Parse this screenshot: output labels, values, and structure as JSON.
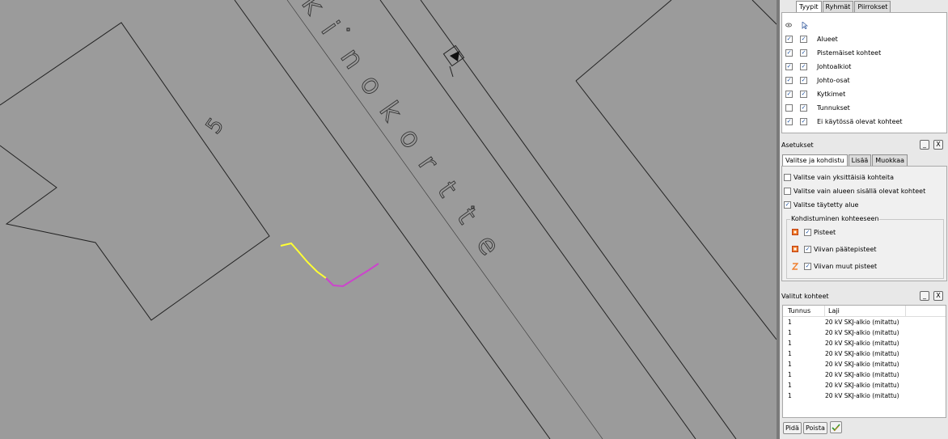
{
  "map": {
    "parcel_number": "5",
    "street_letters": [
      "k",
      "i",
      "n",
      "o",
      "k",
      "o",
      "r",
      "t",
      "t",
      "e"
    ],
    "highlight_colors": {
      "segment_a": "#ffff33",
      "segment_b": "#cc44cc"
    },
    "direction_icon": "triangle-marker-icon"
  },
  "types_panel": {
    "tabs": [
      "Tyypit",
      "Ryhmät",
      "Piirrokset"
    ],
    "col_icons": [
      "eye-icon",
      "pointer-icon"
    ],
    "items": [
      {
        "label": "Alueet",
        "visible": true,
        "selectable": true
      },
      {
        "label": "Pistemäiset kohteet",
        "visible": true,
        "selectable": true
      },
      {
        "label": "Johtoalkiot",
        "visible": true,
        "selectable": true
      },
      {
        "label": "Johto-osat",
        "visible": true,
        "selectable": true
      },
      {
        "label": "Kytkimet",
        "visible": true,
        "selectable": true
      },
      {
        "label": "Tunnukset",
        "visible": false,
        "selectable": true
      },
      {
        "label": "Ei käytössä olevat kohteet",
        "visible": true,
        "selectable": true
      }
    ]
  },
  "settings_panel": {
    "title": "Asetukset",
    "min_label": "_",
    "close_label": "X",
    "tabs": [
      "Valitse ja kohdistu",
      "Lisää",
      "Muokkaa"
    ],
    "options": [
      {
        "label": "Valitse vain yksittäisiä kohteita",
        "checked": false
      },
      {
        "label": "Valitse vain alueen sisällä olevat kohteet",
        "checked": false
      },
      {
        "label": "Valitse täytetty alue",
        "checked": true
      }
    ],
    "snap_group": {
      "title": "Kohdistuminen kohteeseen",
      "items": [
        {
          "label": "Pisteet",
          "checked": true,
          "icon": "point-snap-icon"
        },
        {
          "label": "Viivan päätepisteet",
          "checked": true,
          "icon": "endpoint-snap-icon"
        },
        {
          "label": "Viivan muut pisteet",
          "checked": true,
          "icon": "vertex-snap-icon"
        }
      ]
    }
  },
  "selected_panel": {
    "title": "Valitut kohteet",
    "min_label": "_",
    "close_label": "X",
    "columns": [
      "Tunnus",
      "Laji"
    ],
    "rows": [
      [
        "1",
        "20 kV SKJ-alkio (mitattu)"
      ],
      [
        "1",
        "20 kV SKJ-alkio (mitattu)"
      ],
      [
        "1",
        "20 kV SKJ-alkio (mitattu)"
      ],
      [
        "1",
        "20 kV SKJ-alkio (mitattu)"
      ],
      [
        "1",
        "20 kV SKJ-alkio (mitattu)"
      ],
      [
        "1",
        "20 kV SKJ-alkio (mitattu)"
      ],
      [
        "1",
        "20 kV SKJ-alkio (mitattu)"
      ],
      [
        "1",
        "20 kV SKJ-alkio (mitattu)"
      ]
    ],
    "buttons": {
      "keep": "Pidä",
      "remove": "Poista",
      "apply_icon": "checkmark-pen-icon"
    }
  }
}
